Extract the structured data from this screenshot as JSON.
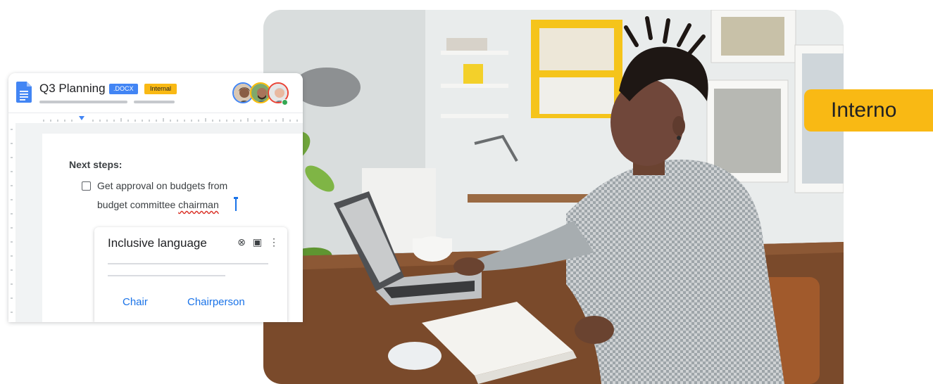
{
  "photo": {
    "alt_icon": "person-at-laptop-photo"
  },
  "badge": {
    "label": "Interno",
    "color": "#f9b914"
  },
  "doc": {
    "title": "Q3 Planning",
    "format_chip": ".DOCX",
    "label_chip": "Internal",
    "content": {
      "heading": "Next steps:",
      "todo_line1": "Get approval on budgets from",
      "todo_line2_prefix": "budget committee ",
      "todo_flagged_word": "chairman"
    },
    "suggestion": {
      "title": "Inclusive language",
      "dismiss_icon": "close-circle-icon",
      "comment_icon": "comment-icon",
      "more_icon": "more-vert-icon",
      "options": [
        "Chair",
        "Chairperson"
      ]
    }
  },
  "colors": {
    "docs_blue": "#4285f4",
    "link_blue": "#1a73e8",
    "internal_yellow": "#f9b914"
  }
}
